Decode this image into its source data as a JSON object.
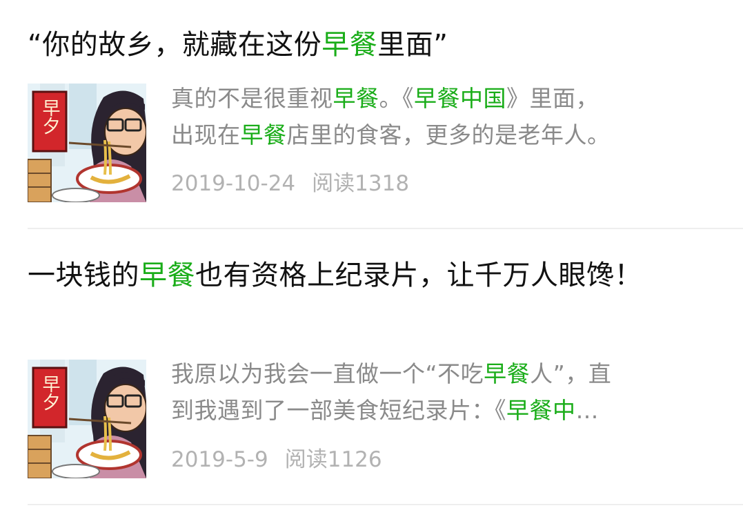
{
  "articles": [
    {
      "title": {
        "prefix": "“你的故乡，就藏在这份",
        "highlight": "早餐",
        "suffix": "里面”"
      },
      "thumbnail": {
        "sign_text": "早夕"
      },
      "excerpt": {
        "line1_a": "真的不是很重视",
        "line1_hl": "早餐",
        "line1_b": "。《",
        "line1_hl2": "早餐中国",
        "line1_c": "》里面，",
        "line2_a": "出现在",
        "line2_hl": "早餐",
        "line2_b": "店里的食客，更多的是老年人。"
      },
      "date": "2019-10-24",
      "reads": "阅读1318"
    },
    {
      "title": {
        "prefix": "一块钱的",
        "highlight": "早餐",
        "suffix": "也有资格上纪录片，让千万人眼馋！"
      },
      "thumbnail": {
        "sign_text": "早夕"
      },
      "excerpt": {
        "line1_a": "我原以为我会一直做一个“不吃",
        "line1_hl": "早餐",
        "line1_b": "人”，直",
        "line2_a": "到我遇到了一部美食短纪录片：《",
        "line2_hl": "早餐中",
        "line2_b": "…"
      },
      "date": "2019-5-9",
      "reads": "阅读1126"
    }
  ],
  "colors": {
    "highlight": "#1aad19",
    "title": "#111111",
    "excerpt": "#8a8a8a",
    "meta": "#b2b2b2"
  }
}
